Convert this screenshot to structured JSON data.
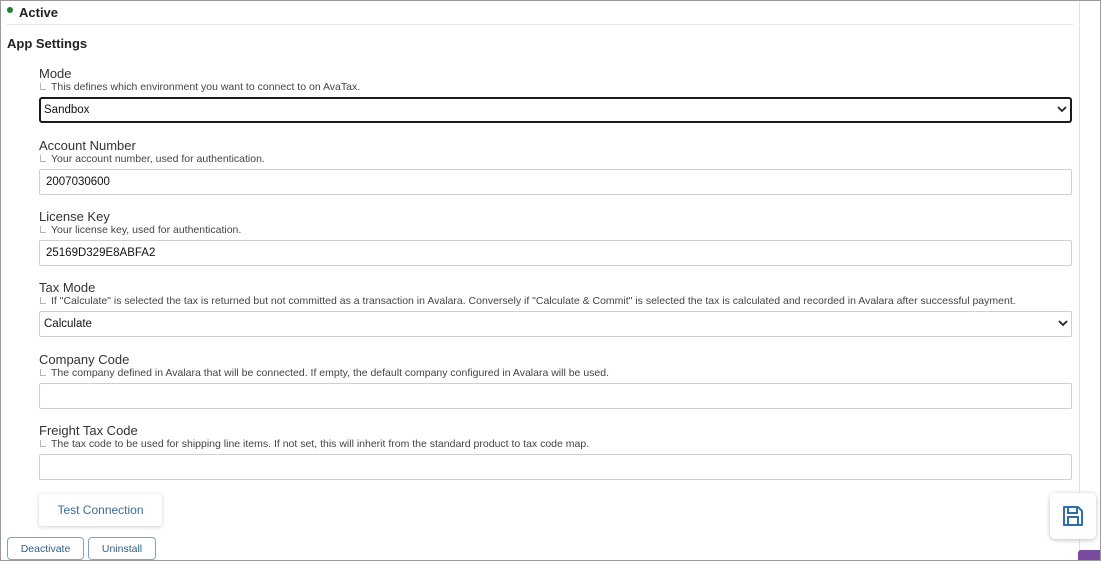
{
  "status": {
    "label": "Active",
    "color": "#1e7e34"
  },
  "section_title": "App Settings",
  "fields": [
    {
      "label": "Mode",
      "help": "This defines which environment you want to connect to on AvaTax.",
      "type": "select",
      "value": "Sandbox",
      "focused": true
    },
    {
      "label": "Account Number",
      "help": "Your account number, used for authentication.",
      "type": "text",
      "value": "2007030600"
    },
    {
      "label": "License Key",
      "help": "Your license key, used for authentication.",
      "type": "text",
      "value": "25169D329E8ABFA2"
    },
    {
      "label": "Tax Mode",
      "help": "If \"Calculate\" is selected the tax is returned but not committed as a transaction in Avalara. Conversely if \"Calculate & Commit\" is selected the tax is calculated and recorded in Avalara after successful payment.",
      "type": "select",
      "value": "Calculate"
    },
    {
      "label": "Company Code",
      "help": "The company defined in Avalara that will be connected. If empty, the default company configured in Avalara will be used.",
      "type": "text",
      "value": ""
    },
    {
      "label": "Freight Tax Code",
      "help": "The tax code to be used for shipping line items. If not set, this will inherit from the standard product to tax code map.",
      "type": "text",
      "value": ""
    }
  ],
  "buttons": {
    "test_connection": "Test Connection",
    "deactivate": "Deactivate",
    "uninstall": "Uninstall"
  },
  "icons": {
    "save": "floppy-disk-icon",
    "select_arrow": "chevron-down-icon"
  },
  "colors": {
    "accent": "#2e5f8a",
    "save_icon": "#2f6ea8",
    "badge": "#7a4aa0"
  }
}
